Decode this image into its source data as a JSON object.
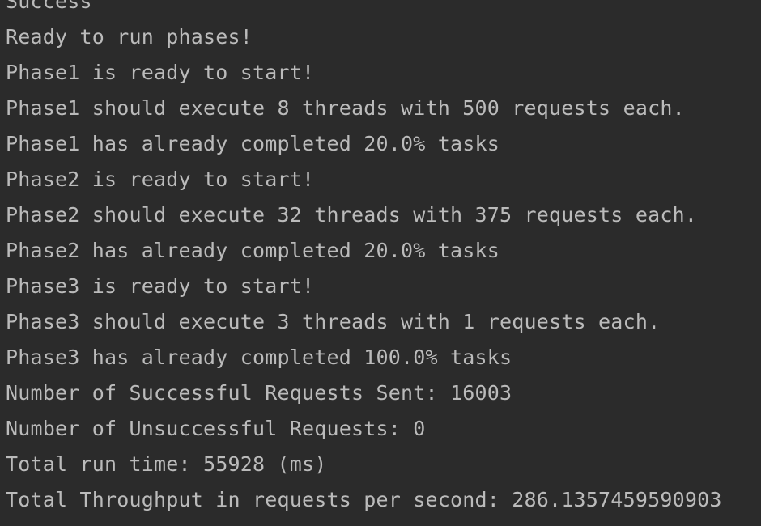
{
  "console": {
    "lines": [
      "Success",
      "Ready to run phases!",
      "Phase1 is ready to start!",
      "Phase1 should execute 8 threads with 500 requests each.",
      "Phase1 has already completed 20.0% tasks",
      "Phase2 is ready to start!",
      "Phase2 should execute 32 threads with 375 requests each.",
      "Phase2 has already completed 20.0% tasks",
      "Phase3 is ready to start!",
      "Phase3 should execute 3 threads with 1 requests each.",
      "Phase3 has already completed 100.0% tasks",
      "Number of Successful Requests Sent: 16003",
      "Number of Unsuccessful Requests: 0",
      "Total run time: 55928 (ms)",
      "Total Throughput in requests per second: 286.1357459590903"
    ]
  },
  "colors": {
    "background": "#2b2b2b",
    "text": "#bbbbbb"
  }
}
